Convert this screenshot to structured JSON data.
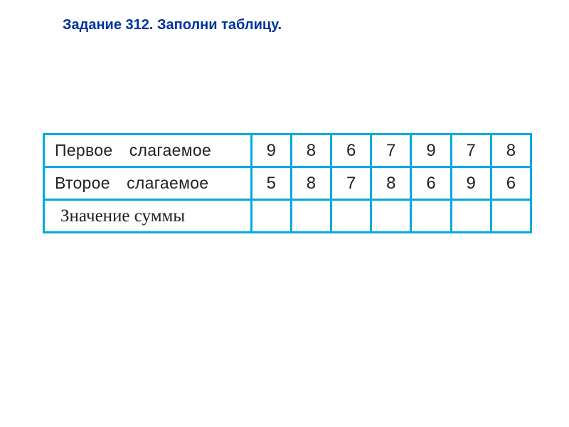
{
  "title": "Задание 312. Заполни таблицу.",
  "rows": {
    "first": {
      "label": "Первое слагаемое",
      "values": [
        "9",
        "8",
        "6",
        "7",
        "9",
        "7",
        "8"
      ]
    },
    "second": {
      "label": "Второе слагаемое",
      "values": [
        "5",
        "8",
        "7",
        "8",
        "6",
        "9",
        "6"
      ]
    },
    "sum": {
      "label": "Значение суммы",
      "values": [
        "",
        "",
        "",
        "",
        "",
        "",
        ""
      ]
    }
  },
  "chart_data": {
    "type": "table",
    "title": "Задание 312. Заполни таблицу.",
    "columns": [
      "",
      "c1",
      "c2",
      "c3",
      "c4",
      "c5",
      "c6",
      "c7"
    ],
    "rows": [
      {
        "label": "Первое слагаемое",
        "values": [
          9,
          8,
          6,
          7,
          9,
          7,
          8
        ]
      },
      {
        "label": "Второе слагаемое",
        "values": [
          5,
          8,
          7,
          8,
          6,
          9,
          6
        ]
      },
      {
        "label": "Значение суммы",
        "values": [
          null,
          null,
          null,
          null,
          null,
          null,
          null
        ]
      }
    ]
  }
}
